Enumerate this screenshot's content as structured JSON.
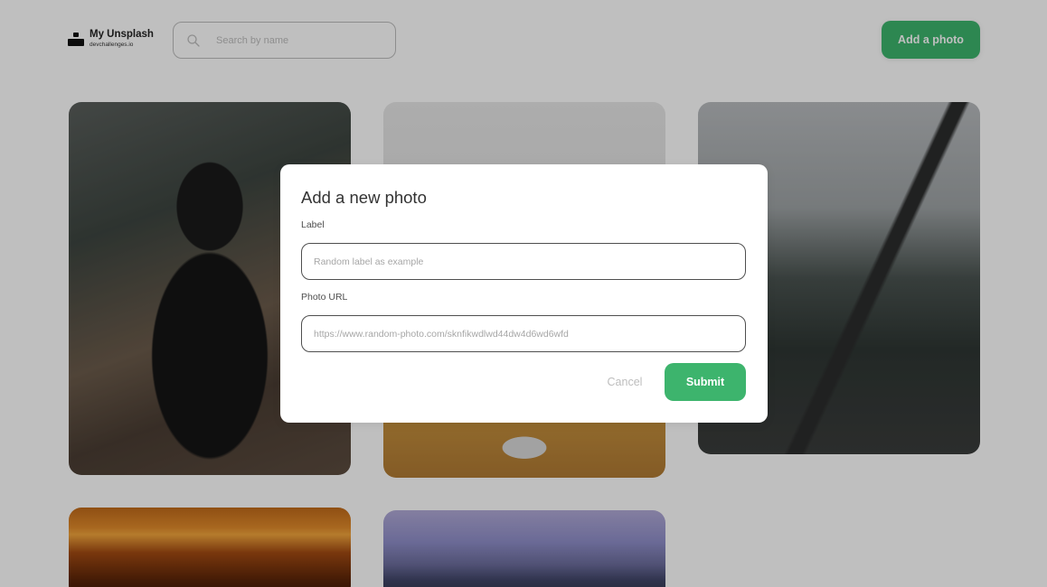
{
  "header": {
    "logo_title": "My Unsplash",
    "logo_subtitle": "devchallenges.io",
    "search_placeholder": "Search by name",
    "add_photo_label": "Add a photo"
  },
  "modal": {
    "title": "Add a new photo",
    "label_field_label": "Label",
    "label_placeholder": "Random label as example",
    "url_field_label": "Photo URL",
    "url_placeholder": "https://www.random-photo.com/sknfikwdlwd44dw4d6wd6wfd",
    "cancel_label": "Cancel",
    "submit_label": "Submit"
  },
  "icons": {
    "logo": "unsplash-logo-icon",
    "search": "search-icon"
  },
  "colors": {
    "accent": "#3db46d",
    "overlay": "rgba(0,0,0,0.25)",
    "input_border": "#4f4f4f",
    "placeholder": "#bdbdbd"
  }
}
